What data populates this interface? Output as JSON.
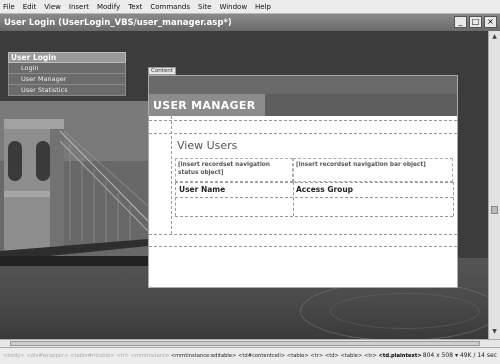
{
  "menu": [
    "File",
    "Edit",
    "View",
    "Insert",
    "Modify",
    "Text",
    "Commands",
    "Site",
    "Window",
    "Help"
  ],
  "window": {
    "title": "User Login (UserLogin_VBS/user_manager.asp*)",
    "minimize": "_",
    "maximize": "□",
    "close": "×"
  },
  "nav": {
    "header": "User Login",
    "items": [
      "Login",
      "User Manager",
      "User Statistics"
    ]
  },
  "editable_region": {
    "tab_label": "Content",
    "banner": "USER MANAGER",
    "heading": "View Users",
    "nav_status_placeholder": "[insert recordset navigation status object]",
    "nav_bar_placeholder": "[insert recordset navigation bar object]",
    "col_username": "User Name",
    "col_accessgroup": "Access Group"
  },
  "statusbar": {
    "tag_faded": "<body> <div#wrapper> <table#mtable> <tr> <mmtinstance",
    "tag_path": "<mmtinstance:editable> <td#contentcell> <table> <tr> <td> <table> <tr>",
    "tag_current": "<td.plaintext>",
    "size": "804 x 508",
    "weight": "49K / 14 sec"
  }
}
